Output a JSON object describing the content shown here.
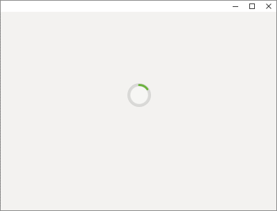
{
  "window": {
    "title": "",
    "controls": {
      "minimize_icon": "minimize-icon",
      "maximize_icon": "maximize-icon",
      "close_icon": "close-icon"
    }
  },
  "loading": {
    "state": "loading",
    "progress_fraction": 0.15,
    "accent_color": "#6cb33e",
    "track_color": "#d9d9d7"
  }
}
